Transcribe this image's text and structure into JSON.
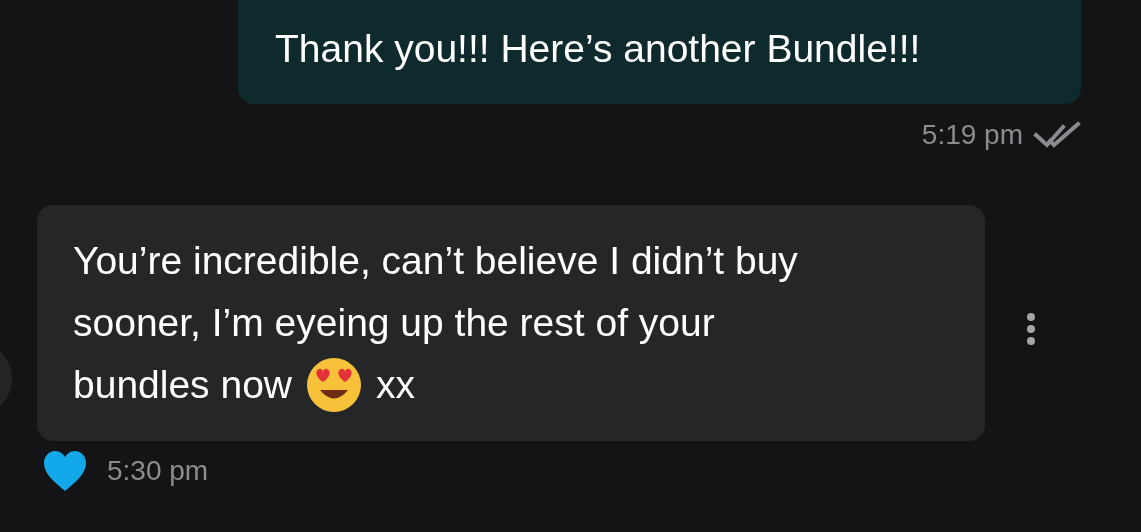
{
  "messages": [
    {
      "kind": "sent",
      "text": "Thank you!!! Here’s another Bundle!!!",
      "time": "5:19 pm",
      "read": true
    },
    {
      "kind": "received",
      "lines": [
        [
          {
            "kind": "text",
            "text": "You’re incredible, can’t believe I didn’t buy"
          }
        ],
        [
          {
            "kind": "text",
            "text": "sooner, I’m eyeing up the rest of your"
          }
        ],
        [
          {
            "kind": "text",
            "text": "bundles now"
          },
          {
            "kind": "emoji"
          },
          {
            "kind": "text",
            "text": "xx"
          }
        ]
      ],
      "time": "5:30 pm",
      "liked": true
    }
  ]
}
